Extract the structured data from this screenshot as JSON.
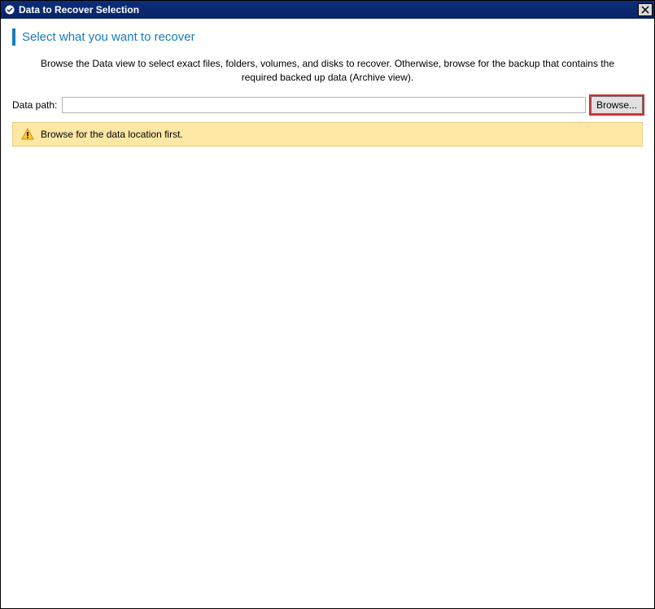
{
  "titlebar": {
    "title": "Data to Recover Selection"
  },
  "section": {
    "heading": "Select what you want to recover",
    "description": "Browse the Data view to select exact files, folders, volumes, and disks to recover. Otherwise, browse for the backup that contains the required backed up data (Archive view)."
  },
  "path": {
    "label": "Data path:",
    "value": "",
    "browse_label": "Browse..."
  },
  "warning": {
    "message": "Browse for the data location first."
  }
}
